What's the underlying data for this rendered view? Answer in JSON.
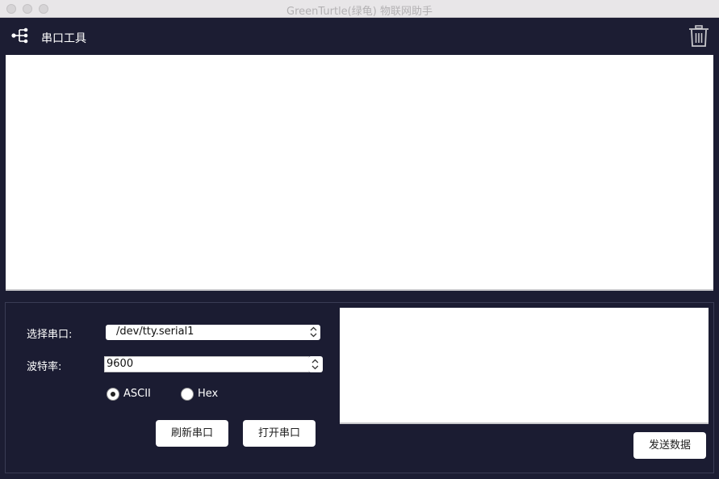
{
  "window": {
    "title": "GreenTurtle(绿龟) 物联网助手"
  },
  "toolbar": {
    "menu_icon": "tree-menu-icon",
    "title": "串口工具",
    "trash_icon": "trash-icon"
  },
  "output": {
    "text": ""
  },
  "settings": {
    "port_label": "选择串口:",
    "port_value": "/dev/tty.serial1",
    "baud_label": "波特率:",
    "baud_value": "9600",
    "encoding_options": [
      {
        "label": "ASCII",
        "selected": true
      },
      {
        "label": "Hex",
        "selected": false
      }
    ],
    "refresh_button": "刷新串口",
    "open_button": "打开串口"
  },
  "send": {
    "text": "",
    "button": "发送数据"
  },
  "colors": {
    "background": "#1c1d33",
    "panel_border": "#3a3c54",
    "titlebar": "#e8e6e8"
  }
}
